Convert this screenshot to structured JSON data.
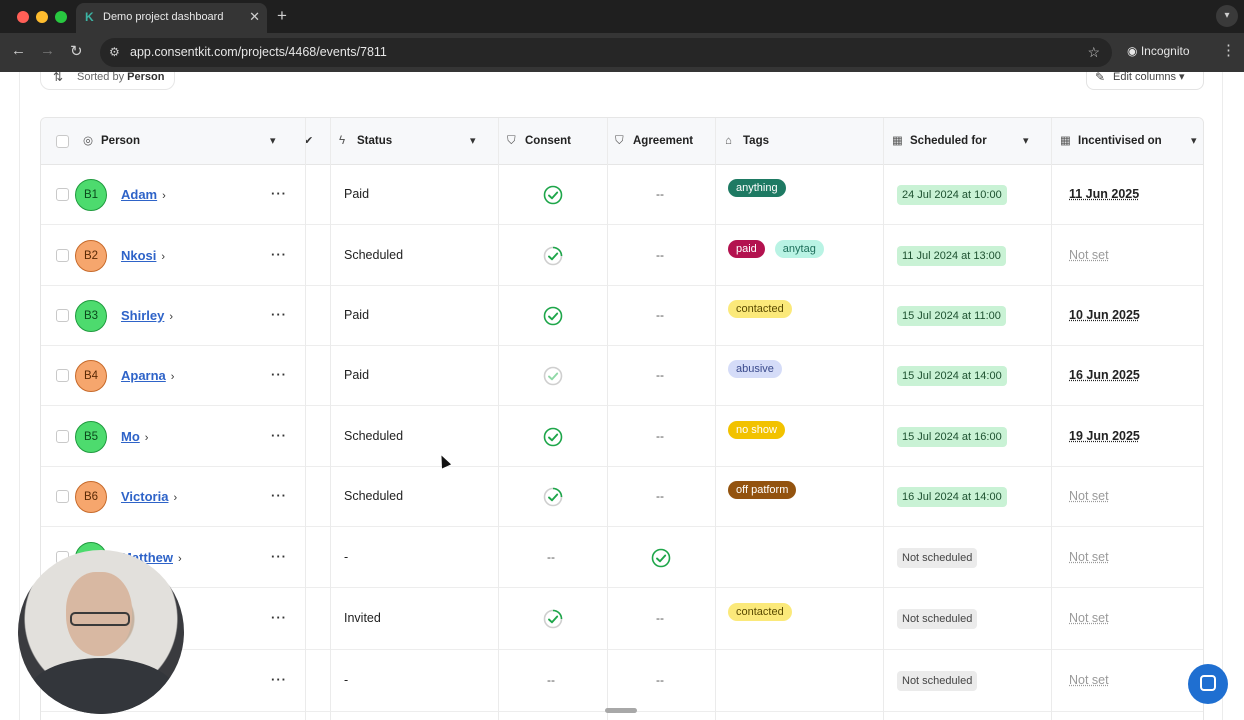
{
  "browser": {
    "tab_title": "Demo project dashboard",
    "url": "app.consentkit.com/projects/4468/events/7811",
    "incognito_label": "Incognito",
    "traffic_colors": [
      "#ff5f57",
      "#febc2e",
      "#28c840"
    ]
  },
  "toolbar": {
    "sorted_prefix": "Sorted by",
    "sorted_field": "Person",
    "edit_columns_label": "Edit columns"
  },
  "columns": {
    "person": "Person",
    "status": "Status",
    "consent": "Consent",
    "agreement": "Agreement",
    "tags": "Tags",
    "scheduled_for": "Scheduled for",
    "incentivised_on": "Incentivised on"
  },
  "rows": [
    {
      "initials": "B1",
      "avatar": "green",
      "name": "Adam",
      "status": "Paid",
      "consent": "check-solid",
      "agreement": "--",
      "tags": [
        {
          "label": "anything",
          "bg": "#1e7a63",
          "fg": "#ffffff"
        }
      ],
      "scheduled": "24 Jul 2024 at 10:00",
      "scheduled_set": true,
      "incentivised": "11 Jun 2025",
      "incentivised_set": true
    },
    {
      "initials": "B2",
      "avatar": "orange",
      "name": "Nkosi",
      "status": "Scheduled",
      "consent": "check-partial",
      "agreement": "--",
      "tags": [
        {
          "label": "paid",
          "bg": "#b3124f",
          "fg": "#ffffff"
        },
        {
          "label": "anytag",
          "bg": "#b9f3e4",
          "fg": "#1d6f5b"
        }
      ],
      "scheduled": "11 Jul 2024 at 13:00",
      "scheduled_set": true,
      "incentivised": "Not set",
      "incentivised_set": false
    },
    {
      "initials": "B3",
      "avatar": "green",
      "name": "Shirley",
      "status": "Paid",
      "consent": "check-solid",
      "agreement": "--",
      "tags": [
        {
          "label": "contacted",
          "bg": "#fbe97a",
          "fg": "#5a4a00"
        }
      ],
      "scheduled": "15 Jul 2024 at 11:00",
      "scheduled_set": true,
      "incentivised": "10 Jun 2025",
      "incentivised_set": true
    },
    {
      "initials": "B4",
      "avatar": "orange",
      "name": "Aparna",
      "status": "Paid",
      "consent": "check-light",
      "agreement": "--",
      "tags": [
        {
          "label": "abusive",
          "bg": "#d5dcf8",
          "fg": "#3a4a8c"
        }
      ],
      "scheduled": "15 Jul 2024 at 14:00",
      "scheduled_set": true,
      "incentivised": "16 Jun 2025",
      "incentivised_set": true
    },
    {
      "initials": "B5",
      "avatar": "green",
      "name": "Mo",
      "status": "Scheduled",
      "consent": "check-solid",
      "agreement": "--",
      "tags": [
        {
          "label": "no show",
          "bg": "#f2c200",
          "fg": "#ffffff"
        }
      ],
      "scheduled": "15 Jul 2024 at 16:00",
      "scheduled_set": true,
      "incentivised": "19 Jun 2025",
      "incentivised_set": true
    },
    {
      "initials": "B6",
      "avatar": "orange",
      "name": "Victoria",
      "status": "Scheduled",
      "consent": "check-partial",
      "agreement": "--",
      "tags": [
        {
          "label": "off patform",
          "bg": "#93530f",
          "fg": "#ffffff"
        }
      ],
      "scheduled": "16 Jul 2024 at 14:00",
      "scheduled_set": true,
      "incentivised": "Not set",
      "incentivised_set": false
    },
    {
      "initials": "",
      "avatar": "green",
      "name": "Matthew",
      "status": "-",
      "consent": "dash",
      "agreement": "check-solid",
      "tags": [],
      "scheduled": "Not scheduled",
      "scheduled_set": false,
      "incentivised": "Not set",
      "incentivised_set": false
    },
    {
      "initials": "",
      "avatar": "none",
      "name": "",
      "status": "Invited",
      "consent": "check-partial",
      "agreement": "--",
      "tags": [
        {
          "label": "contacted",
          "bg": "#fbe97a",
          "fg": "#5a4a00"
        }
      ],
      "scheduled": "Not scheduled",
      "scheduled_set": false,
      "incentivised": "Not set",
      "incentivised_set": false
    },
    {
      "initials": "",
      "avatar": "none",
      "name": "",
      "status": "-",
      "consent": "dash",
      "agreement": "--",
      "tags": [],
      "scheduled": "Not scheduled",
      "scheduled_set": false,
      "incentivised": "Not set",
      "incentivised_set": false
    }
  ],
  "icons": {
    "sort": "sort-icon",
    "edit": "pencil-icon",
    "person": "person-circle-icon",
    "status": "lightning-icon",
    "consent": "shield-check-icon",
    "agreement": "shield-check-icon",
    "tags": "tag-icon",
    "scheduled": "calendar-icon",
    "incentivised": "calendar-icon",
    "chat": "chat-icon"
  },
  "colors": {
    "link": "#2e63c8",
    "check_green": "#1ea64a",
    "scheduled_bg": "#c9f2d5",
    "chat_button": "#1f6fd1"
  }
}
